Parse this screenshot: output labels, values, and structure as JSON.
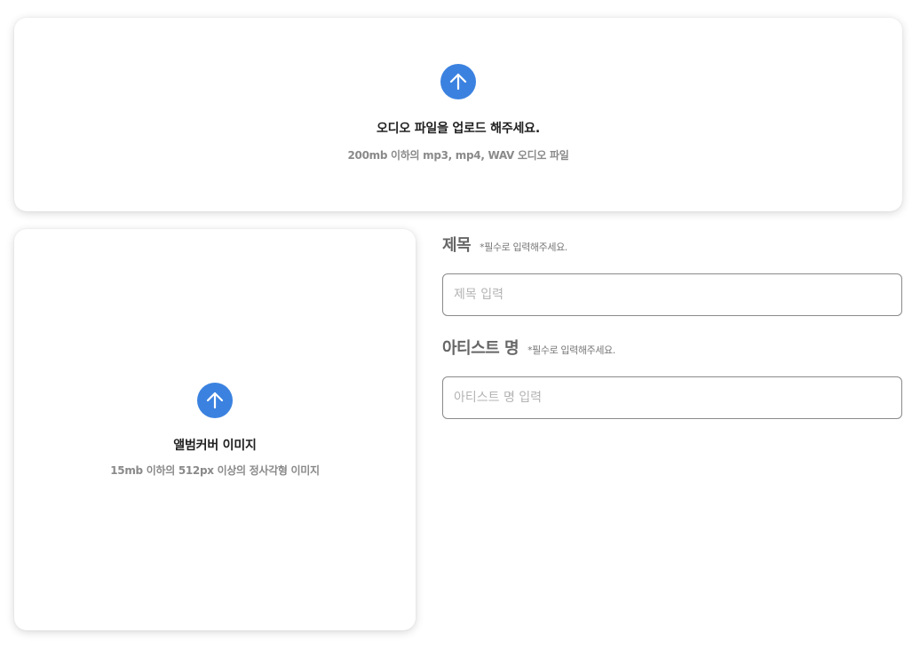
{
  "audio_upload": {
    "title": "오디오 파일을 업로드 해주세요.",
    "subtitle": "200mb 이하의 mp3, mp4, WAV 오디오 파일",
    "icon": "arrow-up-circle-icon"
  },
  "cover_upload": {
    "title": "앨범커버 이미지",
    "subtitle": "15mb 이하의 512px 이상의 정사각형 이미지",
    "icon": "arrow-up-circle-icon"
  },
  "form": {
    "title_field": {
      "label": "제목",
      "note": "*필수로 입력해주세요.",
      "placeholder": "제목 입력",
      "value": ""
    },
    "artist_field": {
      "label": "아티스트 명",
      "note": "*필수로 입력해주세요.",
      "placeholder": "아티스트 명 입력",
      "value": ""
    }
  },
  "colors": {
    "accent": "#3b82e0",
    "border": "#8a8a8a",
    "placeholder": "#b3b3b3"
  }
}
